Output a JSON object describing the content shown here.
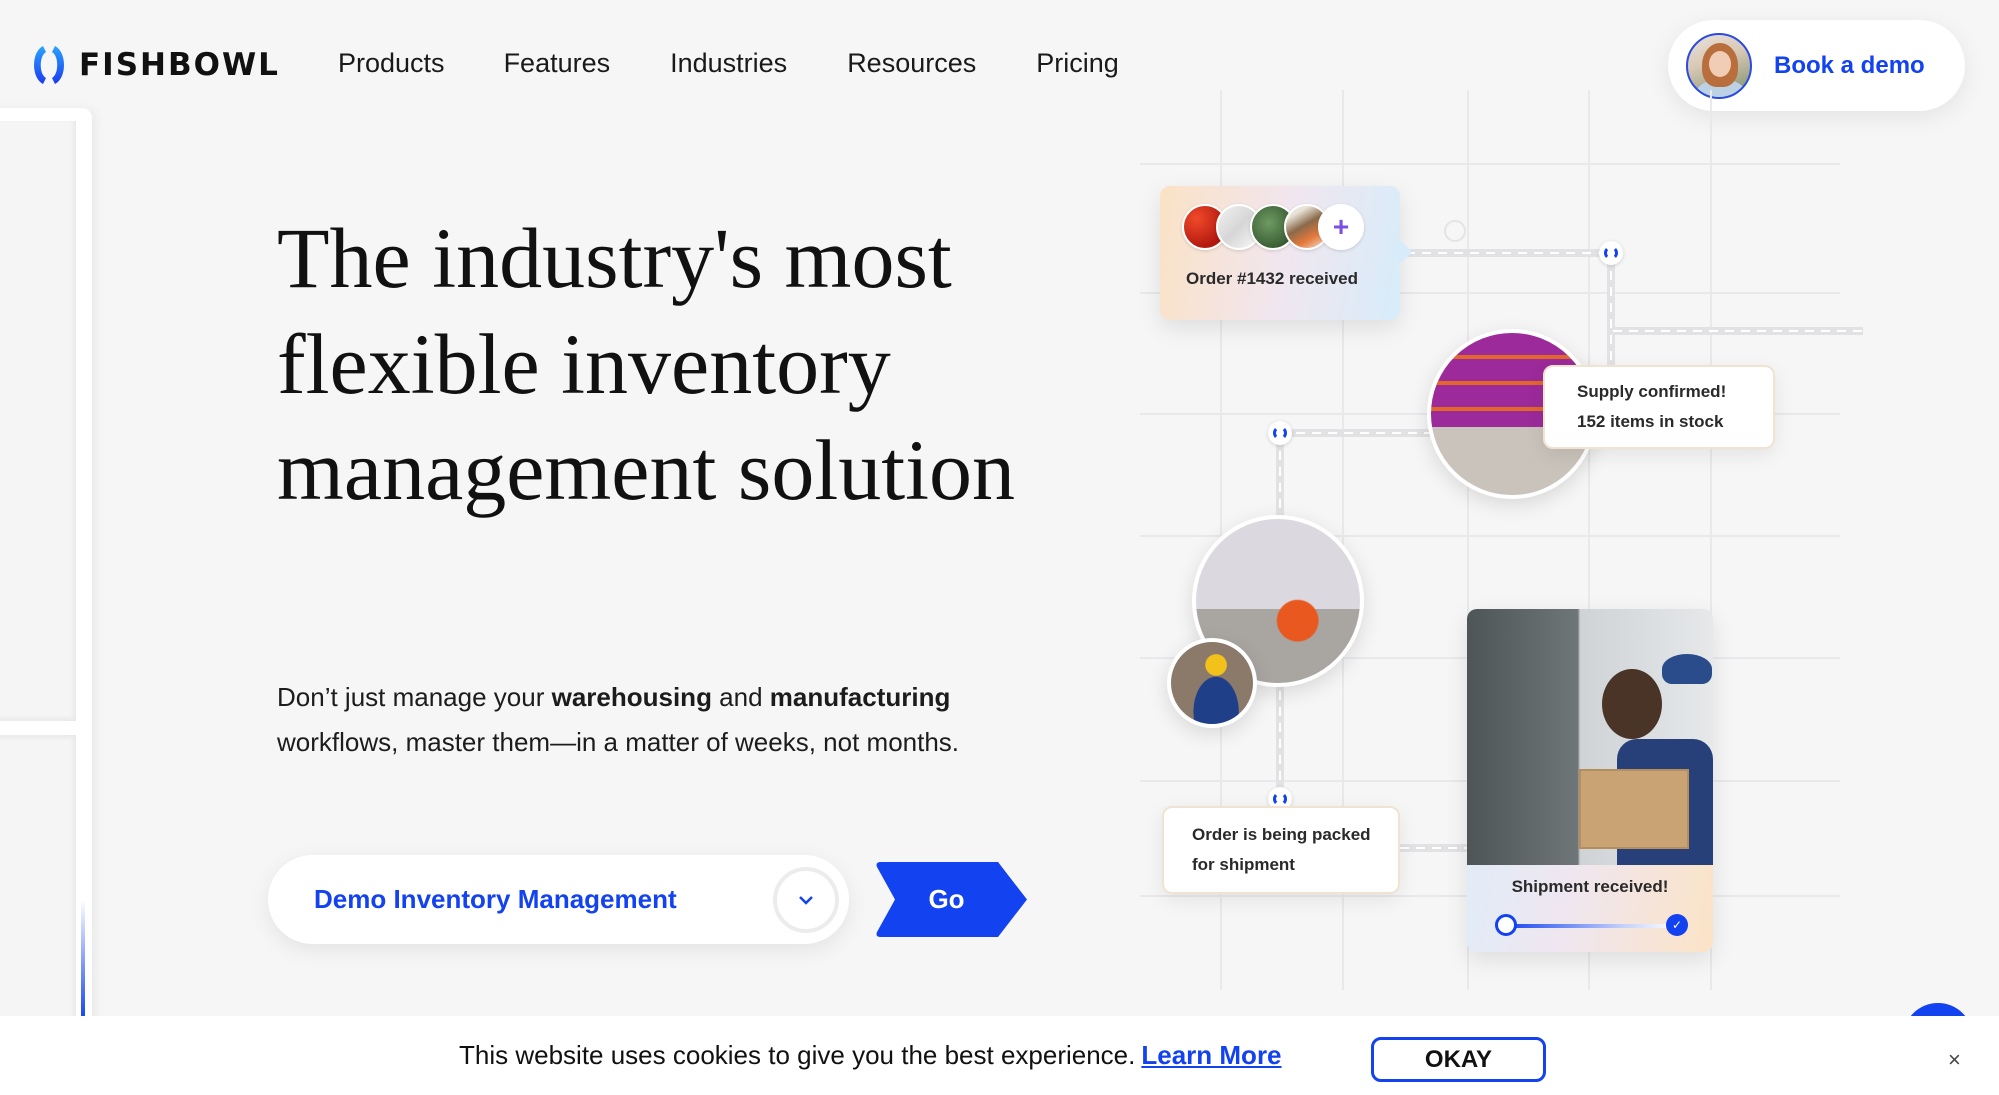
{
  "brand": {
    "name": "FISHBOWL",
    "accent": "#1342f0"
  },
  "nav": {
    "items": [
      {
        "label": "Products"
      },
      {
        "label": "Features"
      },
      {
        "label": "Industries"
      },
      {
        "label": "Resources"
      },
      {
        "label": "Pricing"
      }
    ],
    "cta_label": "Book a demo"
  },
  "hero": {
    "title": "The industry's most flexible inventory management solution",
    "subtitle": {
      "part1": "Don’t just manage your ",
      "bold1": "warehousing",
      "part2": " and ",
      "bold2": "manufacturing",
      "part3": " workflows, master them—in a matter of weeks, not months."
    },
    "select_value": "Demo Inventory Management",
    "go_label": "Go"
  },
  "illustration": {
    "order_card": {
      "text": "Order #1432 received",
      "more_icon": "+"
    },
    "supply_bubble": {
      "line1": "Supply confirmed!",
      "line2": "152 items in stock"
    },
    "packing_bubble": {
      "line1": "Order is being packed",
      "line2": "for shipment"
    },
    "shipment_card": {
      "text": "Shipment received!",
      "progress": 1.0
    }
  },
  "cookie_banner": {
    "text": "This website uses cookies to give you the best experience.",
    "link_label": "Learn More",
    "ok_label": "OKAY",
    "close_icon": "×"
  }
}
